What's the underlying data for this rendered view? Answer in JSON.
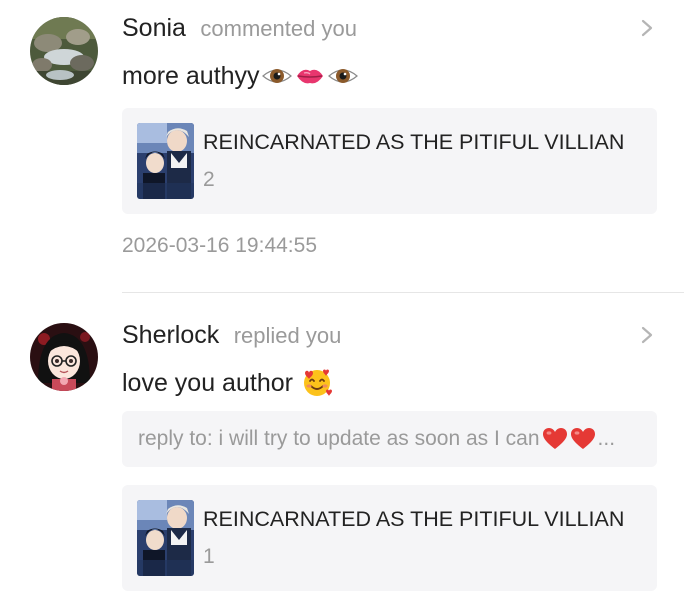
{
  "notifications": [
    {
      "username": "Sonia",
      "action": "commented you",
      "avatar_icon": "avatar-rocky-stream-photo",
      "comment": "more authyy",
      "comment_emojis": [
        "eye-emoji",
        "lips-emoji",
        "eye-emoji"
      ],
      "book": {
        "title": "REINCARNATED AS THE PITIFUL VILLIAN",
        "chapter": "2",
        "cover_icon": "manhwa-cover-art"
      },
      "timestamp": "2026-03-16 19:44:55"
    },
    {
      "username": "Sherlock",
      "action": "replied you",
      "avatar_icon": "avatar-anime-girl-glasses",
      "comment": "love you author",
      "comment_emojis": [
        "smiling-face-with-hearts-emoji"
      ],
      "reply_to": "reply to: i will try to update as soon as I can",
      "reply_to_suffix": "...",
      "reply_to_emojis": [
        "red-heart-emoji",
        "red-heart-emoji"
      ],
      "book": {
        "title": "REINCARNATED AS THE PITIFUL VILLIAN",
        "chapter": "1",
        "cover_icon": "manhwa-cover-art"
      }
    }
  ],
  "colors": {
    "primary_text": "#222222",
    "secondary_text": "#9a9a9a",
    "card_background": "#f5f5f7",
    "divider": "#e6e6e6",
    "heart": "#e53935"
  }
}
